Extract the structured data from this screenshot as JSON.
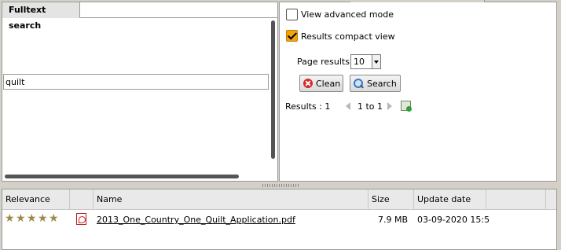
{
  "left_panel": {
    "tab_label": "Fulltext search",
    "search_value": "quilt"
  },
  "right_panel": {
    "advanced_mode_label": "View advanced mode",
    "advanced_mode_checked": false,
    "compact_view_label": "Results compact view",
    "compact_view_checked": true,
    "page_results_label": "Page results",
    "page_results_value": "10",
    "clean_button": "Clean",
    "search_button": "Search",
    "results_label": "Results : 1",
    "pager_text": "1 to 1"
  },
  "grid": {
    "columns": [
      "Relevance",
      "Name",
      "Size",
      "Update date"
    ],
    "rows": [
      {
        "relevance_stars": 5,
        "name": "2013_One_Country_One_Quilt_Application.pdf",
        "size": "7.9 MB",
        "update_date": "03-09-2020 15:5"
      }
    ]
  },
  "colors": {
    "checkbox_checked": "#f0a30a",
    "star": "#9c8a4a",
    "pdf_red": "#b32020"
  }
}
